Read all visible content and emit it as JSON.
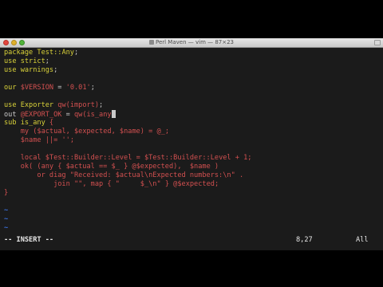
{
  "window": {
    "title": "Perl Maven — vim — 87×23"
  },
  "code": {
    "l1": [
      "package ",
      "Test::Any",
      ";"
    ],
    "l2": [
      "use ",
      "strict",
      ";"
    ],
    "l3": [
      "use ",
      "warnings",
      ";"
    ],
    "l5": [
      "our ",
      "$VERSION",
      " = ",
      "'0.01'",
      ";"
    ],
    "l7": [
      "use ",
      "Exporter",
      " ",
      "qw(import)",
      ";"
    ],
    "l8": [
      "out ",
      "@EXPORT_OK",
      " = ",
      "qw(is_any"
    ],
    "l9": [
      "sub ",
      "is_any",
      " {"
    ],
    "l10": [
      "    my (",
      "$actual",
      ", ",
      "$expected",
      ", ",
      "$name",
      ") = ",
      "@_",
      ";"
    ],
    "l11": [
      "    ",
      "$name",
      " ||= ",
      "''",
      ";"
    ],
    "l13": [
      "    local ",
      "$Test::Builder::Level",
      " = ",
      "$Test::Builder::Level",
      " + 1;"
    ],
    "l14": [
      "    ok( (any { ",
      "$actual",
      " == ",
      "$_",
      " } @",
      "$expected",
      "),  ",
      "$name",
      " )"
    ],
    "l15": [
      "        or diag ",
      "\"Received: $actual\\nExpected numbers:\\n\"",
      " ."
    ],
    "l16": [
      "            join ",
      "\"\"",
      ", map { ",
      "\"     $_\\n\"",
      " } @",
      "$expected",
      ";"
    ],
    "l17": [
      "}"
    ]
  },
  "tildes": [
    "~",
    "~",
    "~"
  ],
  "status": {
    "mode": "-- INSERT --",
    "position": "8,27",
    "scroll": "All"
  }
}
